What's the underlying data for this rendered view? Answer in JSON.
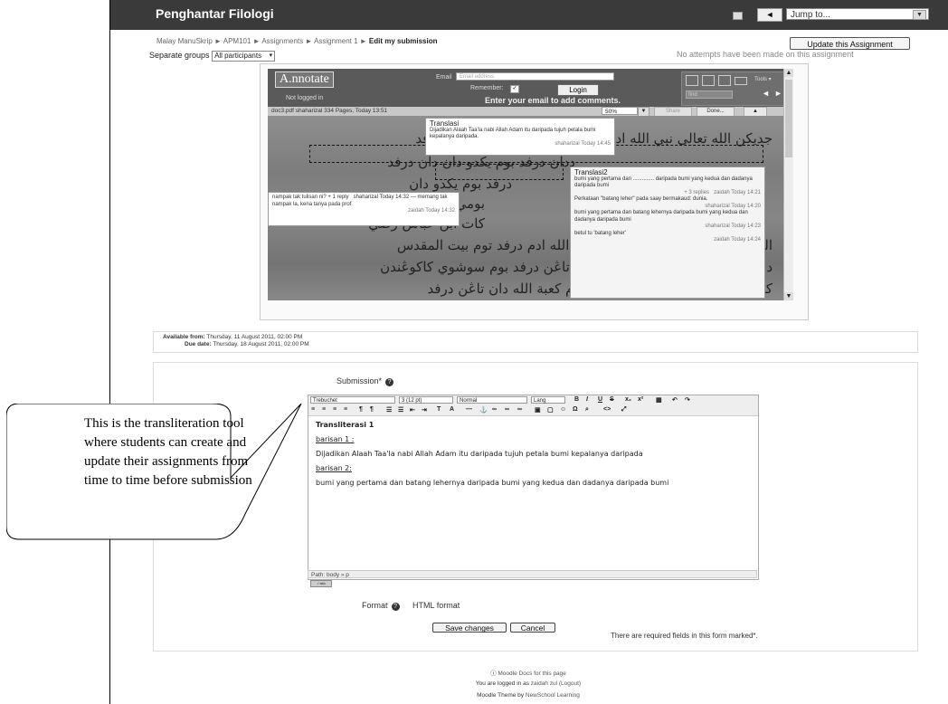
{
  "header": {
    "site_title": "Penghantar Filologi",
    "back_label": "◄",
    "jump_label": "Jump to..."
  },
  "breadcrumb": {
    "items": [
      "Malay ManuSkrip",
      "APM101",
      "Assignments",
      "Assignment 1"
    ],
    "current": "Edit my submission",
    "separator": " ► "
  },
  "update_button": "Update this Assignment",
  "no_attempts": "No attempts have been made on this assignment",
  "groups": {
    "label": "Separate groups",
    "value": "All participants"
  },
  "annotate": {
    "logo": "A.nnotate",
    "not_logged_in": "Not logged in",
    "email_label": "Email",
    "email_placeholder": "Email address",
    "remember_label": "Remember:",
    "login_label": "Login",
    "enter_email_msg": "Enter your email to add comments.",
    "tools_label": "Tools ▾",
    "find_label": "find",
    "doc_info": "doc3.pdf   shaharizal  334 Pages, Today 13:51",
    "zoom": "50%",
    "share_label": "Share",
    "done_label": "Done...",
    "collapse_label": "▲"
  },
  "notes": {
    "translasi": {
      "title": "Translasi",
      "body": "Dijadikan Alaah Taa'la nabi Allah Adam itu daripada tujuh petala bumi kepalanya daripada.",
      "meta": "shaharizal Today 14:45"
    },
    "question": {
      "body": "nampak tak tulisan ni?",
      "replies": "+ 1 reply",
      "meta1": "shaharizal Today 14:32",
      "reply": "— memang tak nampak la, kena tanya pada prof",
      "meta2": "zaidah Today 14:32"
    },
    "translasi2": {
      "title": "Translasi2",
      "body1": "bumi yang pertama dan .............. daripada bumi yang kedua dan dadanya daripada bumi",
      "replies": "+ 3 replies",
      "meta1": "zaidah Today 14:21",
      "body2": "Perkataan \"batang leher\" pada saay bermakaud: dunia.",
      "meta2": "shaharizal Today 14:20",
      "body3": "bumi yang pertama dan batang lehernya daripada bumi yang kedua dan dadanya daripada bumi",
      "meta3": "shaharizal Today 14:23",
      "body4": "betul tu 'batang leher'",
      "meta4": "zaidah Today 14:24"
    }
  },
  "manuscript_lines": [
    "جديكن الله تعالى نبي الله ادم درفد توجه فتالا بومي كفالان درفد",
    "ددان درفد بوم يكدو دان دان درفد",
    "درفد بوم يكدو دان",
    "بومي درفد بوم يكاد",
    "كات ابن عباس رضي",
    "الله عنهما بهو جديكن الله تعالى نبي الله ادم درفد توم بيت المقدس",
    "دان كاكين درفد بوم شرك دان كدو دتاڠن درفد بوم سوشوي كاكوڠندن",
    "كالبڠ درفد بوم هيند دان داڠ درفد بوم كعبة الله دان تاڠن درفد"
  ],
  "dates": {
    "available_label": "Available from:",
    "available_value": "Thursday, 11 August 2011, 02:00 PM",
    "due_label": "Due date:",
    "due_value": "Thursday, 18 August 2011, 02:00 PM"
  },
  "form": {
    "submission_label": "Submission*",
    "font_family": "Trebuchet",
    "font_size": "3 (12 pt)",
    "block_format": "Normal",
    "lang": "Lang",
    "path": "Path:  body » p",
    "content": {
      "heading": "Transliterasi 1",
      "label1": "barisan 1 :",
      "para1": "Dijadikan Alaah Taa'la nabi Allah Adam itu daripada tujuh petala bumi kepalanya daripada",
      "label2": "barisan 2:",
      "para2": "bumi yang pertama dan batang lehernya daripada bumi yang kedua dan dadanya daripada bumi"
    },
    "format_label": "Format",
    "format_value": "HTML format",
    "save_label": "Save changes",
    "cancel_label": "Cancel",
    "required_note": "There are required fields in this form marked*."
  },
  "footer": {
    "docs_link": "Moodle Docs for this page",
    "logged_prefix": "You are logged in as",
    "user": "zaidah zul",
    "logout": "(Logout)",
    "theme_prefix": "Moodle Theme by",
    "theme_author": "NewSchool Learning"
  },
  "callout": {
    "text": "This is the transliteration tool where students can create and update their assignments from time to time before submission"
  }
}
